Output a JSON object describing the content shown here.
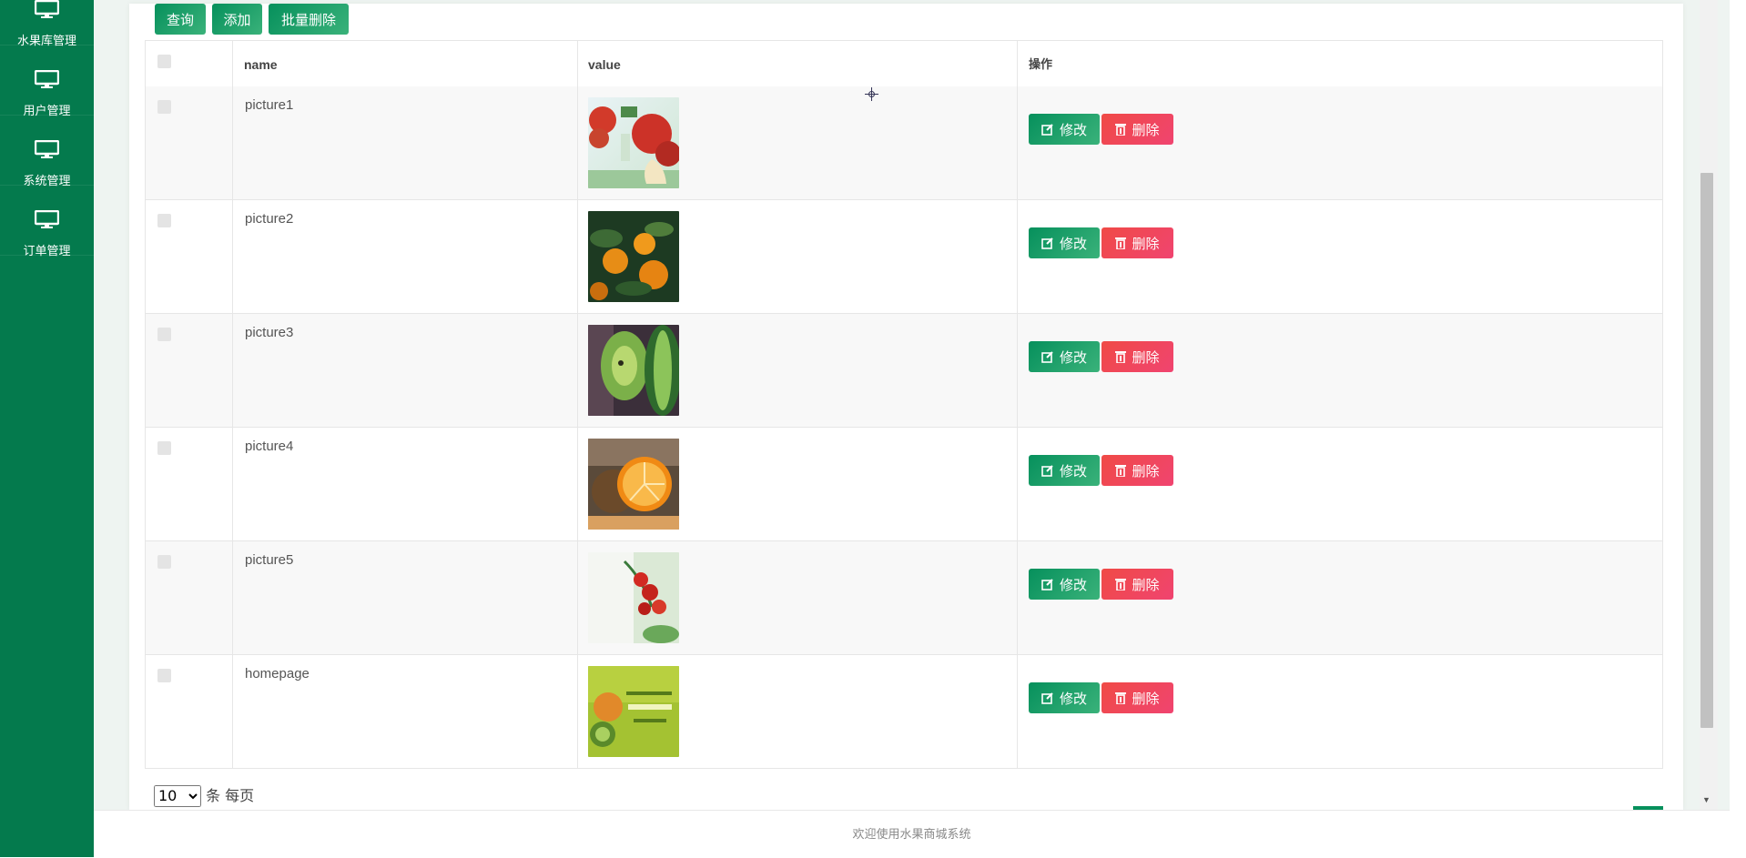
{
  "sidebar": {
    "items": [
      {
        "label": "水果库管理"
      },
      {
        "label": "用户管理"
      },
      {
        "label": "系统管理"
      },
      {
        "label": "订单管理"
      }
    ]
  },
  "toolbar": {
    "query_label": "查询",
    "add_label": "添加",
    "batch_delete_label": "批量删除"
  },
  "table": {
    "columns": [
      "name",
      "value",
      "操作"
    ],
    "rows": [
      {
        "name": "picture1",
        "image": "red apples banner"
      },
      {
        "name": "picture2",
        "image": "oranges on branch"
      },
      {
        "name": "picture3",
        "image": "sliced kiwi"
      },
      {
        "name": "picture4",
        "image": "orange halves"
      },
      {
        "name": "picture5",
        "image": "cherry tomatoes"
      },
      {
        "name": "homepage",
        "image": "green fruit banner"
      }
    ],
    "edit_label": "修改",
    "delete_label": "删除"
  },
  "pager": {
    "page_size": "10",
    "page_size_options": [
      "10"
    ],
    "suffix": "条 每页"
  },
  "footer": {
    "text": "欢迎使用水果商城系统"
  },
  "colors": {
    "sidebar": "#047a4d",
    "primary": "#06905c",
    "danger": "#f04a46"
  }
}
